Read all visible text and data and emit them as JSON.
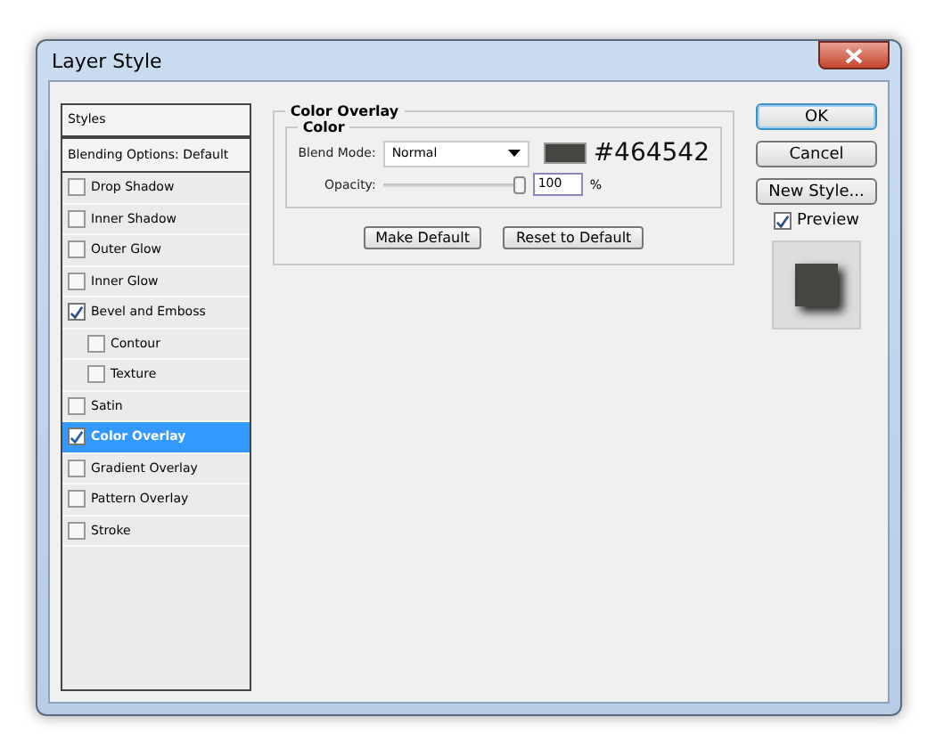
{
  "window": {
    "title": "Layer Style"
  },
  "styles_panel": {
    "header": "Styles",
    "blending": "Blending Options: Default",
    "items": [
      {
        "label": "Drop Shadow",
        "checked": false,
        "selected": false
      },
      {
        "label": "Inner Shadow",
        "checked": false,
        "selected": false
      },
      {
        "label": "Outer Glow",
        "checked": false,
        "selected": false
      },
      {
        "label": "Inner Glow",
        "checked": false,
        "selected": false
      },
      {
        "label": "Bevel and Emboss",
        "checked": true,
        "selected": false,
        "children": [
          {
            "label": "Contour",
            "checked": false,
            "selected": false
          },
          {
            "label": "Texture",
            "checked": false,
            "selected": false
          }
        ]
      },
      {
        "label": "Satin",
        "checked": false,
        "selected": false
      },
      {
        "label": "Color Overlay",
        "checked": true,
        "selected": true
      },
      {
        "label": "Gradient Overlay",
        "checked": false,
        "selected": false
      },
      {
        "label": "Pattern Overlay",
        "checked": false,
        "selected": false
      },
      {
        "label": "Stroke",
        "checked": false,
        "selected": false
      }
    ]
  },
  "color_overlay": {
    "title": "Color Overlay",
    "group": "Color",
    "blend_mode_label": "Blend Mode:",
    "blend_mode": "Normal",
    "color": "#464542",
    "color_hex": "#464542",
    "opacity_label": "Opacity:",
    "opacity": {
      "level": 1.0
    },
    "opacity_value": "100",
    "opacity_unit": "%",
    "buttons": [
      "Make Default",
      "Reset to Default"
    ]
  },
  "actions": {
    "ok": "OK",
    "cancel": "Cancel",
    "new_style": "New Style...",
    "preview": {
      "label": "Preview",
      "checked": true
    }
  }
}
